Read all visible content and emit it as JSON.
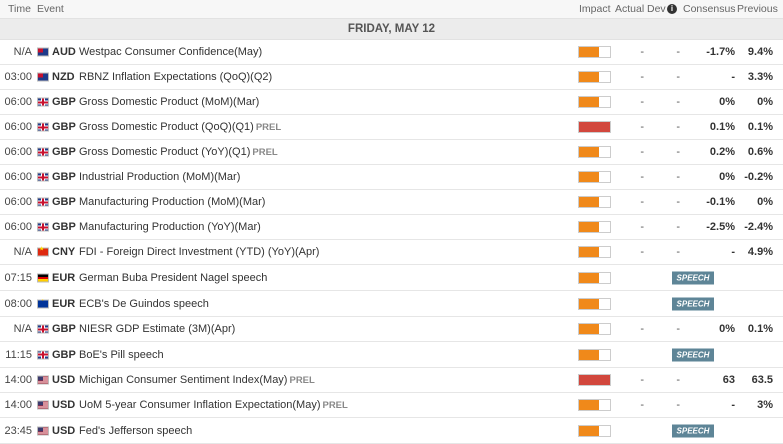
{
  "header": {
    "time": "Time",
    "event": "Event",
    "impact": "Impact",
    "actual": "Actual",
    "dev": "Dev",
    "info": "i",
    "consensus": "Consensus",
    "previous": "Previous"
  },
  "day_label": "FRIDAY, MAY 12",
  "colors": {
    "impact_medium": "#f0891a",
    "impact_high": "#d2473d",
    "speech_badge": "#5e8597"
  },
  "speech_label": "SPEECH",
  "rows": [
    {
      "time": "N/A",
      "flag": "aud",
      "currency": "AUD",
      "event": "Westpac Consumer Confidence(May)",
      "prel": "",
      "impact": "medium",
      "actual": "-",
      "dev": "-",
      "consensus": "-1.7%",
      "previous": "9.4%"
    },
    {
      "time": "03:00",
      "flag": "nzd",
      "currency": "NZD",
      "event": "RBNZ Inflation Expectations (QoQ)(Q2)",
      "prel": "",
      "impact": "medium",
      "actual": "-",
      "dev": "-",
      "consensus": "-",
      "previous": "3.3%"
    },
    {
      "time": "06:00",
      "flag": "gbp",
      "currency": "GBP",
      "event": "Gross Domestic Product (MoM)(Mar)",
      "prel": "",
      "impact": "medium",
      "actual": "-",
      "dev": "-",
      "consensus": "0%",
      "previous": "0%"
    },
    {
      "time": "06:00",
      "flag": "gbp",
      "currency": "GBP",
      "event": "Gross Domestic Product (QoQ)(Q1)",
      "prel": "PREL",
      "impact": "high",
      "actual": "-",
      "dev": "-",
      "consensus": "0.1%",
      "previous": "0.1%"
    },
    {
      "time": "06:00",
      "flag": "gbp",
      "currency": "GBP",
      "event": "Gross Domestic Product (YoY)(Q1)",
      "prel": "PREL",
      "impact": "medium",
      "actual": "-",
      "dev": "-",
      "consensus": "0.2%",
      "previous": "0.6%"
    },
    {
      "time": "06:00",
      "flag": "gbp",
      "currency": "GBP",
      "event": "Industrial Production (MoM)(Mar)",
      "prel": "",
      "impact": "medium",
      "actual": "-",
      "dev": "-",
      "consensus": "0%",
      "previous": "-0.2%"
    },
    {
      "time": "06:00",
      "flag": "gbp",
      "currency": "GBP",
      "event": "Manufacturing Production (MoM)(Mar)",
      "prel": "",
      "impact": "medium",
      "actual": "-",
      "dev": "-",
      "consensus": "-0.1%",
      "previous": "0%"
    },
    {
      "time": "06:00",
      "flag": "gbp",
      "currency": "GBP",
      "event": "Manufacturing Production (YoY)(Mar)",
      "prel": "",
      "impact": "medium",
      "actual": "-",
      "dev": "-",
      "consensus": "-2.5%",
      "previous": "-2.4%"
    },
    {
      "time": "N/A",
      "flag": "cny",
      "currency": "CNY",
      "event": "FDI - Foreign Direct Investment (YTD) (YoY)(Apr)",
      "prel": "",
      "impact": "medium",
      "actual": "-",
      "dev": "-",
      "consensus": "-",
      "previous": "4.9%"
    },
    {
      "time": "07:15",
      "flag": "eur-de",
      "currency": "EUR",
      "event": "German Buba President Nagel speech",
      "prel": "",
      "impact": "medium",
      "speech": true,
      "actual": "",
      "dev": "",
      "consensus": "",
      "previous": ""
    },
    {
      "time": "08:00",
      "flag": "eur",
      "currency": "EUR",
      "event": "ECB's De Guindos speech",
      "prel": "",
      "impact": "medium",
      "speech": true,
      "actual": "",
      "dev": "",
      "consensus": "",
      "previous": ""
    },
    {
      "time": "N/A",
      "flag": "gbp",
      "currency": "GBP",
      "event": "NIESR GDP Estimate (3M)(Apr)",
      "prel": "",
      "impact": "medium",
      "actual": "-",
      "dev": "-",
      "consensus": "0%",
      "previous": "0.1%"
    },
    {
      "time": "11:15",
      "flag": "gbp",
      "currency": "GBP",
      "event": "BoE's Pill speech",
      "prel": "",
      "impact": "medium",
      "speech": true,
      "actual": "",
      "dev": "",
      "consensus": "",
      "previous": ""
    },
    {
      "time": "14:00",
      "flag": "usd",
      "currency": "USD",
      "event": "Michigan Consumer Sentiment Index(May)",
      "prel": "PREL",
      "impact": "high",
      "actual": "-",
      "dev": "-",
      "consensus": "63",
      "previous": "63.5"
    },
    {
      "time": "14:00",
      "flag": "usd",
      "currency": "USD",
      "event": "UoM 5-year Consumer Inflation Expectation(May)",
      "prel": "PREL",
      "impact": "medium",
      "actual": "-",
      "dev": "-",
      "consensus": "-",
      "previous": "3%"
    },
    {
      "time": "23:45",
      "flag": "usd",
      "currency": "USD",
      "event": "Fed's Jefferson speech",
      "prel": "",
      "impact": "medium",
      "speech": true,
      "actual": "",
      "dev": "",
      "consensus": "",
      "previous": ""
    }
  ]
}
